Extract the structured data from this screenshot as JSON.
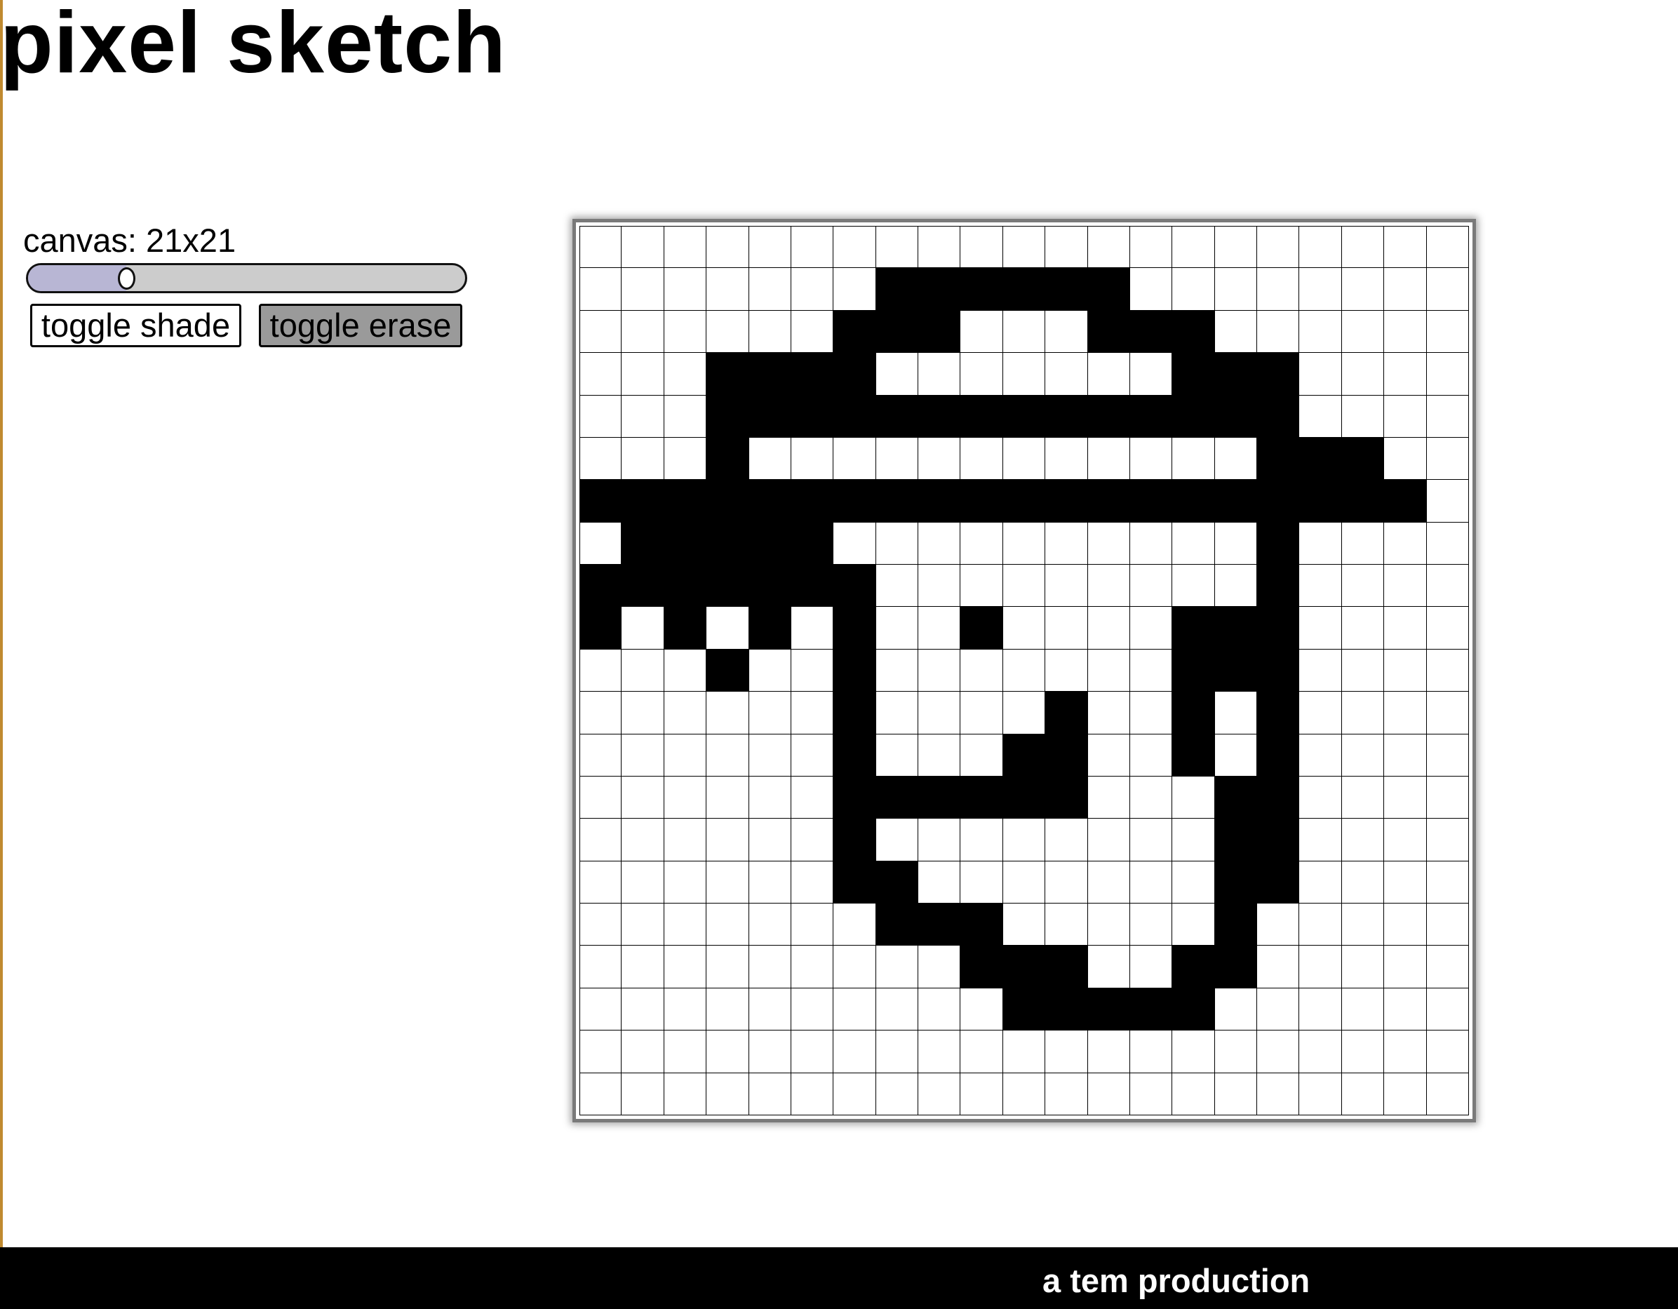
{
  "app": {
    "title": "pixel sketch"
  },
  "controls": {
    "canvas_label": "canvas: 21x21",
    "size_slider": {
      "min": 1,
      "max": 100,
      "value": 21
    },
    "shade_button_label": "toggle shade",
    "erase_button_label": "toggle erase",
    "erase_active": true
  },
  "colors": {
    "background": "#ffffff",
    "ink": "#000000",
    "slider_fill": "#b8b6d4",
    "slider_track": "#cccccc",
    "erase_button_active": "#9a9a9a",
    "footer_background": "#000000",
    "footer_text": "#ffffff",
    "left_edge": "#c08a30"
  },
  "canvas": {
    "rows": 21,
    "cols": 21,
    "pixels": [
      "000000000000000000000",
      "000000011111100000000",
      "000000111000111000000",
      "000111100000001110000",
      "000111111111111110000",
      "000100000000000011100",
      "111111111111111111110",
      "011111000000000010000",
      "111111100000000010000",
      "101010100100001110000",
      "000100100000001110000",
      "000000100001001010000",
      "000000100011001010000",
      "000000111111000110000",
      "000000100000000110000",
      "000000110000000110000",
      "000000011100000100000",
      "000000000111001100000",
      "000000000011111000000",
      "000000000000000000000",
      "000000000000000000000"
    ]
  },
  "footer": {
    "text": "a tem production"
  }
}
